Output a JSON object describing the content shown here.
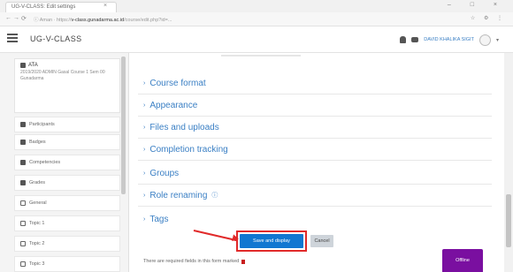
{
  "browser": {
    "tab_title": "UG-V-CLASS: Edit settings",
    "tab_close": "×",
    "url_prefix": "ⓘ Aman · https://",
    "url_host": "v-class.gunadarma.ac.id",
    "url_path": "/course/edit.php?id=...",
    "window_controls": "– □ ×",
    "address_icons": "☆ ⚙ ⋮"
  },
  "header": {
    "site_name": "UG-V-CLASS",
    "user_name": "DAVID KHALIKA SIGIT",
    "caret": "▾"
  },
  "sidebar": {
    "course": {
      "code": "ATA",
      "description": "2019/2020 ADMIN Gasal Course 1 Sem 00 Gunadarma"
    },
    "items": [
      {
        "label": "Participants",
        "icon": "users-icon"
      },
      {
        "label": "Badges",
        "icon": "badge-icon"
      },
      {
        "label": "Competencies",
        "icon": "competencies-icon"
      },
      {
        "label": "Grades",
        "icon": "grades-icon"
      },
      {
        "label": "General",
        "icon": "folder-icon"
      },
      {
        "label": "Topic 1",
        "icon": "folder-icon"
      },
      {
        "label": "Topic 2",
        "icon": "folder-icon"
      },
      {
        "label": "Topic 3",
        "icon": "folder-icon"
      }
    ]
  },
  "sections": [
    {
      "title": "Course format"
    },
    {
      "title": "Appearance"
    },
    {
      "title": "Files and uploads"
    },
    {
      "title": "Completion tracking"
    },
    {
      "title": "Groups"
    },
    {
      "title": "Role renaming"
    },
    {
      "title": "Tags"
    }
  ],
  "section_chevron": "›",
  "role_help_mark": "ⓘ",
  "actions": {
    "save_label": "Save and display",
    "cancel_label": "Cancel"
  },
  "required_note": "There are required fields in this form marked",
  "offline_label": "Offline",
  "colors": {
    "accent": "#3a7fc4",
    "primary_button": "#1177d1",
    "highlight": "#e12a2a",
    "offline": "#7a0fa0"
  }
}
